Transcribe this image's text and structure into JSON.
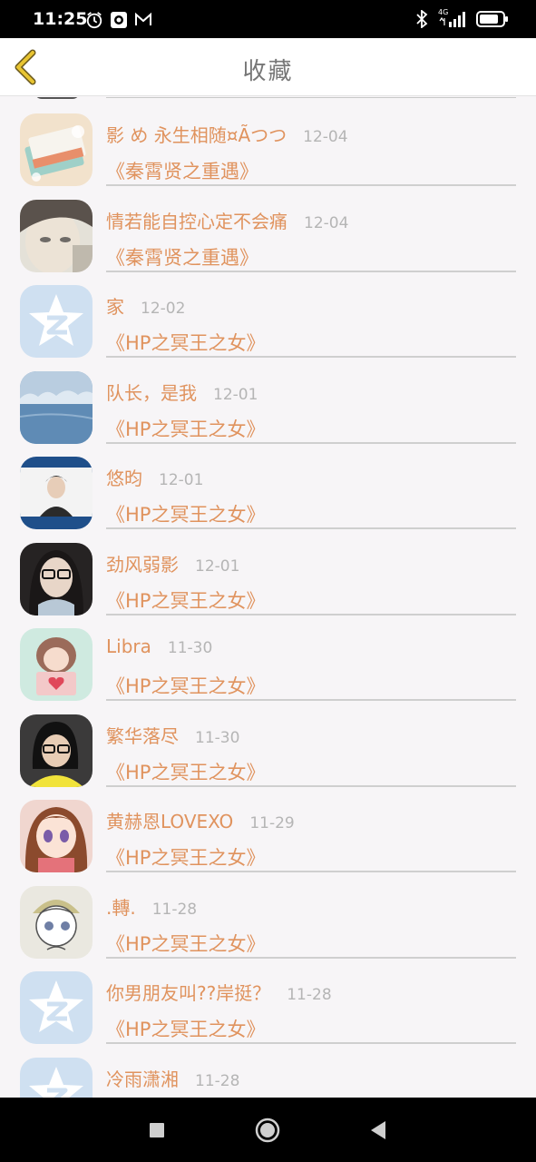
{
  "status_bar": {
    "time": "11:25",
    "network": "4G"
  },
  "header": {
    "title": "收藏"
  },
  "items": [
    {
      "name": "影 め 永生相随¤Ãつつ",
      "date": "12-04",
      "book": "《秦霄贤之重遇》",
      "avatar": "notebook"
    },
    {
      "name": "情若能自控心定不会痛",
      "date": "12-04",
      "book": "《秦霄贤之重遇》",
      "avatar": "face-light"
    },
    {
      "name": "家",
      "date": "12-02",
      "book": "《HP之冥王之女》",
      "avatar": "default"
    },
    {
      "name": "队长，是我",
      "date": "12-01",
      "book": "《HP之冥王之女》",
      "avatar": "snow"
    },
    {
      "name": "悠昀",
      "date": "12-01",
      "book": "《HP之冥王之女》",
      "avatar": "portrait-blue"
    },
    {
      "name": "劲风弱影",
      "date": "12-01",
      "book": "《HP之冥王之女》",
      "avatar": "glasses-dark"
    },
    {
      "name": "Libra",
      "date": "11-30",
      "book": "《HP之冥王之女》",
      "avatar": "girl-heart"
    },
    {
      "name": "繁华落尽",
      "date": "11-30",
      "book": "《HP之冥王之女》",
      "avatar": "glasses-yellow"
    },
    {
      "name": "黄赫恩LOVEXO",
      "date": "11-29",
      "book": "《HP之冥王之女》",
      "avatar": "anime-brown"
    },
    {
      "name": ".轉.",
      "date": "11-28",
      "book": "《HP之冥王之女》",
      "avatar": "anime-sketch"
    },
    {
      "name": "你男朋友叫??岸挺？",
      "date": "11-28",
      "book": "《HP之冥王之女》",
      "avatar": "default"
    },
    {
      "name": "冷雨潇湘",
      "date": "11-28",
      "book": "",
      "avatar": "default"
    }
  ],
  "colors": {
    "accent": "#e0935e",
    "date": "#b5b5b5",
    "back_arrow": "#e8c431",
    "default_avatar": "#cfe0f1"
  }
}
